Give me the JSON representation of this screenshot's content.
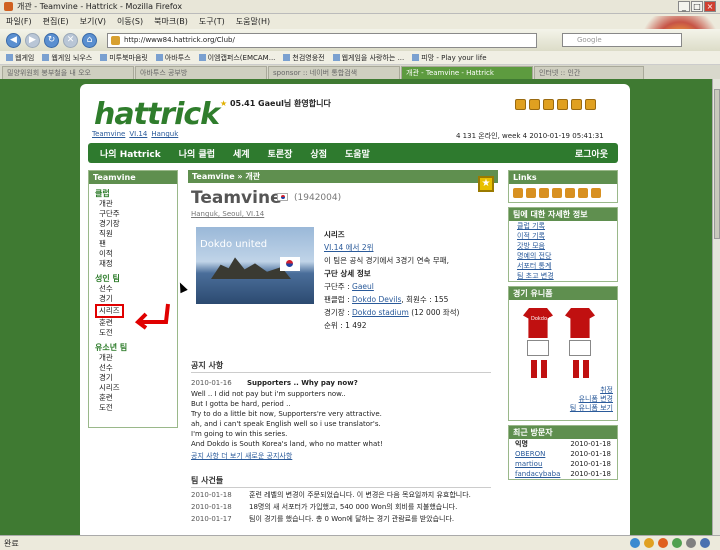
{
  "browser": {
    "title": "개관 - Teamvine - Hattrick - Mozilla Firefox",
    "menu": [
      "파일(F)",
      "편집(E)",
      "보기(V)",
      "이동(S)",
      "북마크(B)",
      "도구(T)",
      "도움말(H)"
    ],
    "url": "http://www84.hattrick.org/Club/",
    "search_placeholder": "Google",
    "bookmarks": [
      "웹게임",
      "웹게임 뇌우스",
      "미투북마음릿",
      "아바투스",
      "이엠캡퍼스(EMCAM...",
      "천검영웅전",
      "웹게임을 사랑하는 ...",
      "피망 - Play your life"
    ],
    "tabs": [
      "밀양위원회 봉부철을 내 오오",
      "아바투스 공부방",
      "sponsor :: 네이버 통합검색",
      "개관 - Teamvine - Hattrick",
      "인터넷 :: 인간"
    ],
    "status": "완료"
  },
  "site": {
    "logo": "hattrick",
    "greeting": "05.41 Gaeul님 환영합니다",
    "toplinks": [
      "Teamvine",
      "VI.14",
      "Hanguk"
    ],
    "online": "4 131 온라인, week 4  2010-01-19 05:41:31",
    "nav": [
      "나의 Hattrick",
      "나의 클럽",
      "세계",
      "토론장",
      "상점",
      "도움말"
    ],
    "logout": "로그아웃"
  },
  "left": {
    "header": "Teamvine",
    "club_title": "클럽",
    "club_items": [
      "개관",
      "구단주",
      "경기장",
      "직원",
      "팬",
      "이적",
      "재정"
    ],
    "senior_title": "성인 팀",
    "senior_items": [
      "선수",
      "경기",
      "시리즈",
      "훈련",
      "도전"
    ],
    "youth_title": "유소년 팀",
    "youth_items": [
      "개관",
      "선수",
      "경기",
      "시리즈",
      "훈련",
      "도전"
    ]
  },
  "main": {
    "header": "Teamvine » 개관",
    "team_name": "Teamvine",
    "team_id": "(1942004)",
    "sublinks": "Hanguk, Seoul, VI.14",
    "photo_text": "Dokdo united",
    "photo_flag": "Dokdo is in Korea",
    "series_title": "시리즈",
    "series_line": "VI.14 에서 2위",
    "series_line2": "이 팀은 공식 경기에서 3경기 연속 무패,",
    "club_info_title": "구단 상세 정보",
    "owner_label": "구단주 :",
    "owner": "Gaeul",
    "fanclub_label": "팬클럽 :",
    "fanclub": "Dokdo Devils",
    "fanclub_members": ", 회원수 : 155",
    "stadium_label": "경기장 :",
    "stadium": "Dokdo stadium",
    "stadium_seats": "(12 000 좌석)",
    "rank_label": "순위 :",
    "rank": "1 492",
    "news_title": "공지 사항",
    "news_date": "2010-01-16",
    "news_subject": "Supporters .. Why pay now?",
    "news_body": [
      "Well .. I did not pay but i'm supporters now..",
      "But I gotta be hard, period ..",
      "Try to do a little bit now, Supporters're very attractive.",
      "ah, and i can't speak English well so i use translator's.",
      "I'm going to win this series.",
      "And Dokdo is South Korea's land, who no matter what!"
    ],
    "news_links": "공지 사항 더 보기  새로운 공지사항",
    "events_title": "팀 사건들",
    "events": [
      {
        "date": "2010-01-18",
        "text": "훈련 레벨의 변경이 주문되었습니다. 이 변경은 다음 목요일까지 유효합니다."
      },
      {
        "date": "2010-01-18",
        "text": "18명의 새 서포터가 가입했고, 540 000 Won의 회비를 지불했습니다."
      },
      {
        "date": "2010-01-17",
        "text": "팀이 경기를 했습니다. 총 0 Won에 달하는 경기 관람료를 받았습니다."
      }
    ]
  },
  "right": {
    "links_title": "Links",
    "detail_title": "팀에 대한 자세한 정보",
    "detail_items": [
      "클럽 기록",
      "이적 기록",
      "갓방 모음",
      "명예의 전당",
      "서포터 통계",
      "팀 초고 변경"
    ],
    "kit_title": "경기 유니폼",
    "kit_text": "Dokdo utd.",
    "kit_links": [
      "유니폼 변경",
      "팀 유니폼 보기"
    ],
    "kit_links_top": "취정",
    "visitors_title": "최근 방문자",
    "visitors": [
      {
        "name": "익명",
        "date": "2010-01-18"
      },
      {
        "name": "OBERON",
        "date": "2010-01-18"
      },
      {
        "name": "martiou",
        "date": "2010-01-18"
      },
      {
        "name": "fandacybaba",
        "date": "2010-01-18"
      }
    ]
  }
}
